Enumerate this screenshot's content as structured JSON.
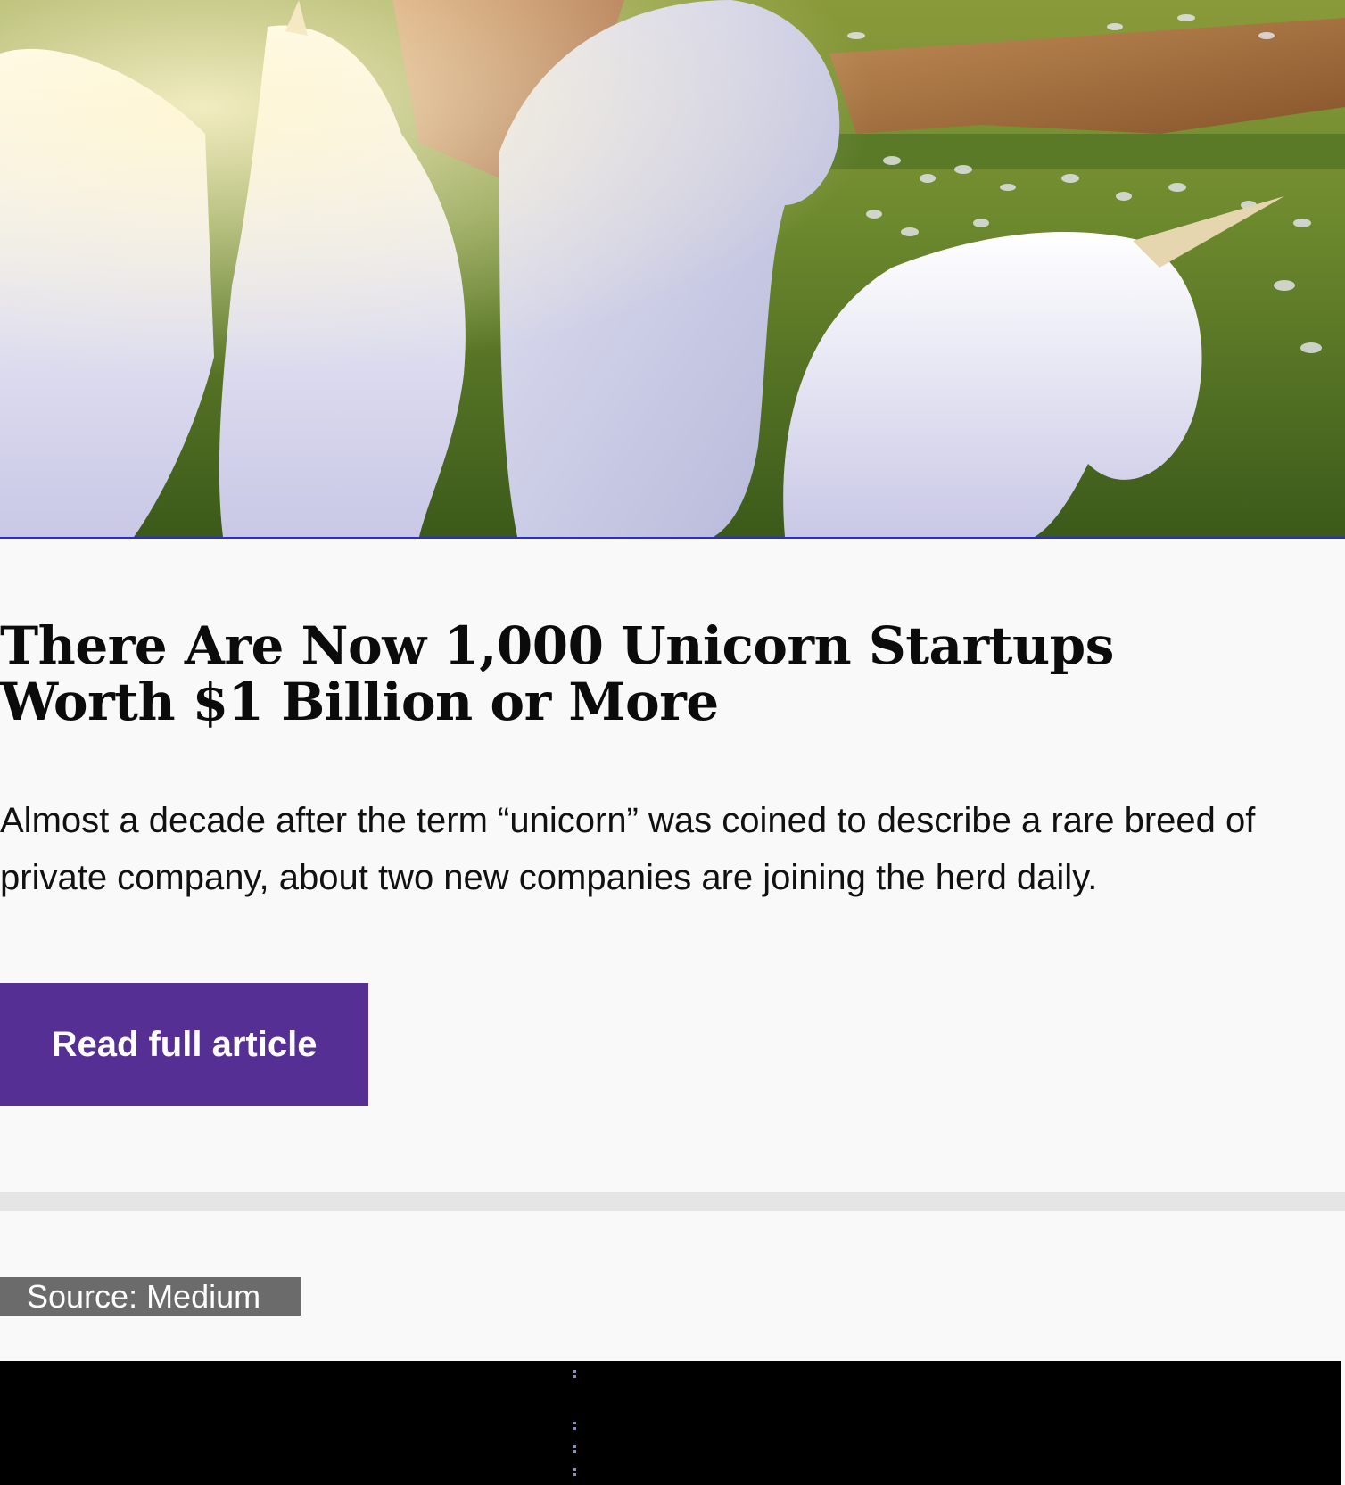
{
  "article": {
    "image_alt": "Herd of white unicorns running across a grassy canyon plateau",
    "title": "There Are Now 1,000 Unicorn Startups Worth $1 Billion or More",
    "summary": "Almost a decade after the term “unicorn” was coined to describe a rare breed of private company, about two new companies are joining the herd daily.",
    "read_button_label": "Read full article",
    "button_color": "#552f93"
  },
  "source": {
    "label": "Source: Medium"
  }
}
